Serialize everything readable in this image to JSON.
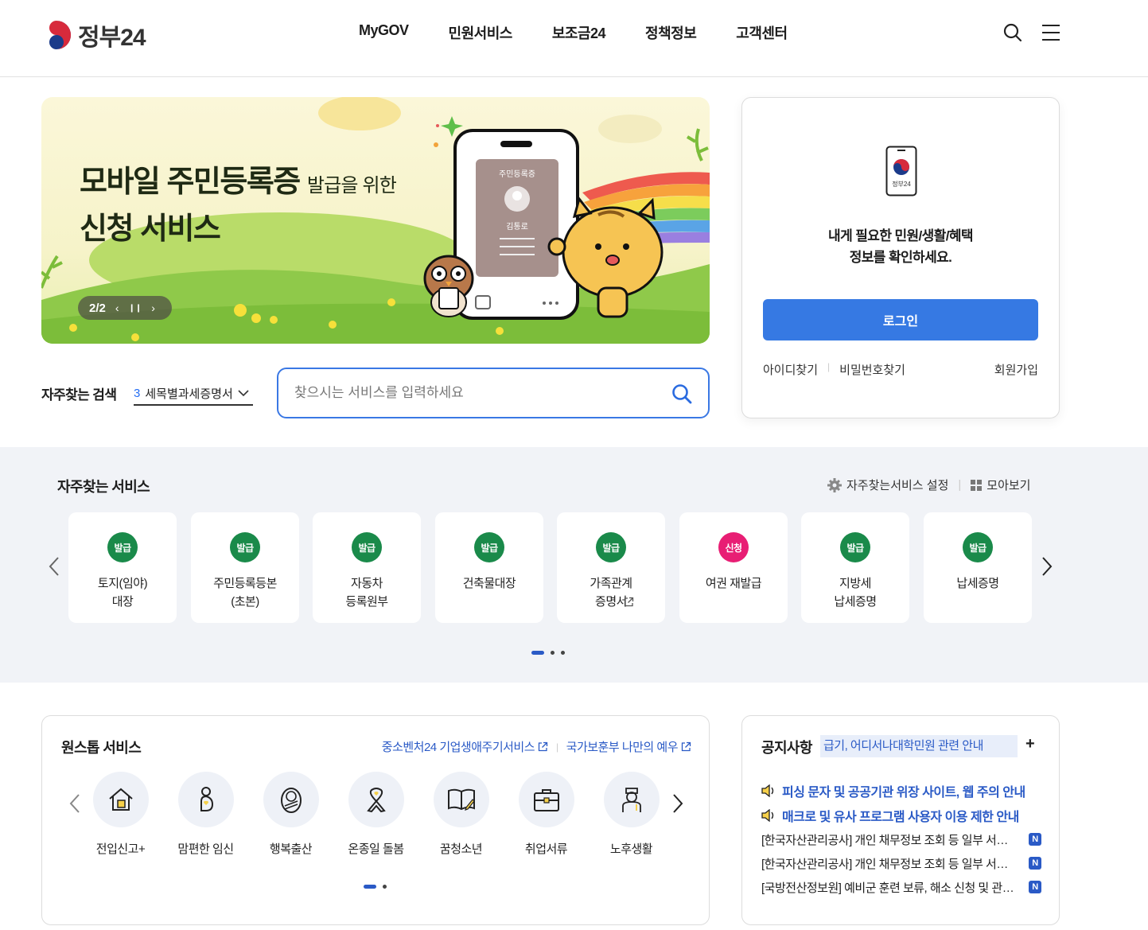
{
  "header": {
    "logo_text": "정부24",
    "nav": [
      "MyGOV",
      "민원서비스",
      "보조금24",
      "정책정보",
      "고객센터"
    ],
    "icons": [
      "search-icon",
      "menu-icon"
    ]
  },
  "banner": {
    "title_line1": "모바일 주민등록증",
    "title_small": "발급을 위한",
    "title_line2": "신청 서비스",
    "card_title": "주민등록증",
    "card_name": "김통로",
    "counter": "2/2"
  },
  "search": {
    "freq_label": "자주찾는 검색",
    "freq_num": "3",
    "freq_text": "세목별과세증명서",
    "placeholder": "찾으시는 서비스를 입력하세요"
  },
  "login": {
    "phone_caption": "정부24",
    "message_line1": "내게 필요한 민원/생활/혜택",
    "message_line2": "정보를 확인하세요.",
    "button": "로그인",
    "find_id": "아이디찾기",
    "find_pw": "비밀번호찾기",
    "join": "회원가입"
  },
  "frequent": {
    "title": "자주찾는 서비스",
    "settings": "자주찾는서비스 설정",
    "view_all": "모아보기",
    "cards": [
      {
        "badge": "발급",
        "label": "토지(임야)\n대장"
      },
      {
        "badge": "발급",
        "label": "주민등록등본\n(초본)"
      },
      {
        "badge": "발급",
        "label": "자동차\n등록원부"
      },
      {
        "badge": "발급",
        "label": "건축물대장"
      },
      {
        "badge": "발급",
        "label": "가족관계\n증명서"
      },
      {
        "badge": "신청",
        "label": "여권 재발급"
      },
      {
        "badge": "발급",
        "label": "지방세\n납세증명"
      },
      {
        "badge": "발급",
        "label": "납세증명"
      }
    ]
  },
  "onestop": {
    "title": "원스톱 서비스",
    "link1": "중소벤처24 기업생애주기서비스",
    "link2": "국가보훈부 나만의 예우",
    "items": [
      {
        "icon": "house-icon",
        "label": "전입신고+"
      },
      {
        "icon": "pregnancy-icon",
        "label": "맘편한 임신"
      },
      {
        "icon": "baby-icon",
        "label": "행복출산"
      },
      {
        "icon": "ribbon-icon",
        "label": "온종일 돌봄"
      },
      {
        "icon": "book-icon",
        "label": "꿈청소년"
      },
      {
        "icon": "briefcase-icon",
        "label": "취업서류"
      },
      {
        "icon": "elderly-icon",
        "label": "노후생활"
      }
    ]
  },
  "notice": {
    "title": "공지사항",
    "ticker": "급기, 어디서나대학민원 관련 안내",
    "items": [
      {
        "text": "피싱 문자 및 공공기관 위장 사이트, 웹 주의 안내",
        "highlight": true
      },
      {
        "text": "매크로 및 유사 프로그램 사용자 이용 제한 안내",
        "highlight": true
      },
      {
        "text": "[한국자산관리공사] 개인 채무정보 조회 등 일부 서비스 일시 중단 안내",
        "highlight": false,
        "badge": "N"
      },
      {
        "text": "[한국자산관리공사] 개인 채무정보 조회 등 일부 서비스 일시 중단 안내",
        "highlight": false,
        "badge": "N"
      },
      {
        "text": "[국방전산정보원] 예비군 훈련 보류, 해소 신청 및 관련 서비스 안내",
        "highlight": false,
        "badge": "N"
      }
    ]
  },
  "colors": {
    "primary": "#3679e3",
    "badge_issue": "#1a8a4a",
    "badge_apply": "#e81e74",
    "link_blue": "#2a5ac6",
    "section_bg": "#f1f3f7"
  }
}
